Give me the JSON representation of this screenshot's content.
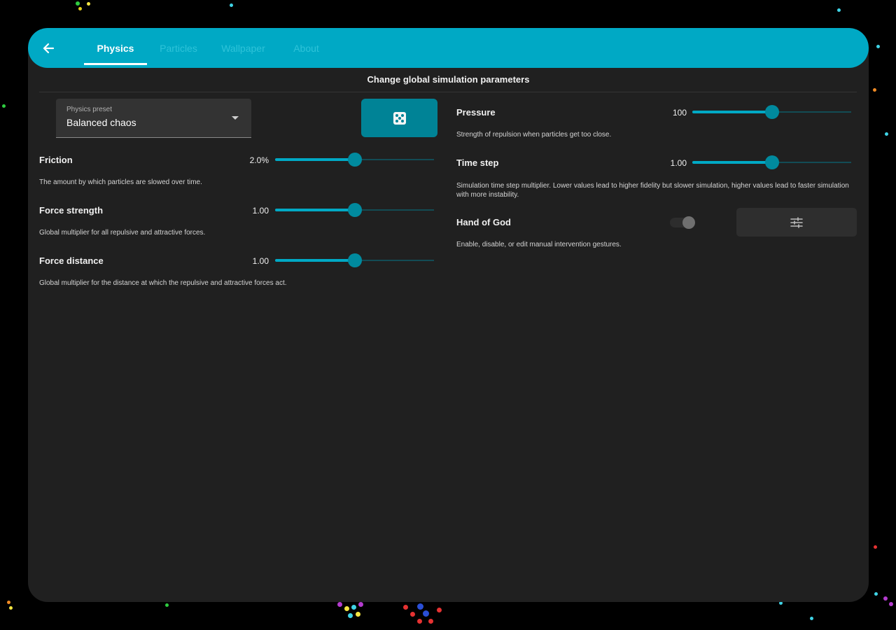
{
  "header": {
    "tabs": [
      {
        "label": "Physics"
      },
      {
        "label": "Particles"
      },
      {
        "label": "Wallpaper"
      },
      {
        "label": "About"
      }
    ],
    "active_tab": "Physics"
  },
  "subtitle": "Change global simulation parameters",
  "preset": {
    "label": "Physics preset",
    "value": "Balanced chaos"
  },
  "left_settings": [
    {
      "title": "Friction",
      "value": "2.0%",
      "level": 0.5,
      "description": "The amount by which particles are slowed over time."
    },
    {
      "title": "Force strength",
      "value": "1.00",
      "level": 0.5,
      "description": "Global multiplier for all repulsive and attractive forces."
    },
    {
      "title": "Force distance",
      "value": "1.00",
      "level": 0.5,
      "description": "Global multiplier for the distance at which the repulsive and attractive forces act."
    }
  ],
  "right_settings": [
    {
      "title": "Pressure",
      "value": "100",
      "level": 0.5,
      "description": "Strength of repulsion when particles get too close."
    },
    {
      "title": "Time step",
      "value": "1.00",
      "level": 0.5,
      "description": "Simulation time step multiplier. Lower values lead to higher fidelity but slower simulation, higher values lead to faster simulation with more instability."
    }
  ],
  "hand_of_god": {
    "title": "Hand of God",
    "enabled": false,
    "description": "Enable, disable, or edit manual intervention gestures."
  },
  "icons": {
    "back": "arrow-left-icon",
    "randomize": "dice-icon",
    "dropdown": "caret-down-icon",
    "settings": "sliders-icon"
  },
  "colors": {
    "accent": "#00a9c5",
    "accent_dark": "#008396",
    "panel": "#202020",
    "background": "#000000"
  }
}
